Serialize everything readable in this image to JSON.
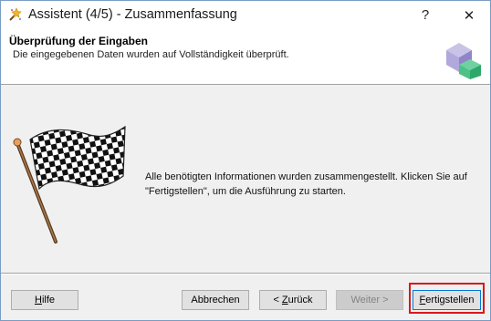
{
  "window": {
    "title": "Assistent (4/5) - Zusammenfassung",
    "help_glyph": "?",
    "close_glyph": "✕"
  },
  "header": {
    "title": "Überprüfung der Eingaben",
    "subtitle": "Die eingegebenen Daten wurden auf Vollständigkeit überprüft."
  },
  "content": {
    "message": "Alle benötigten Informationen wurden zusammengestellt. Klicken Sie auf \"Fertigstellen\", um die Ausführung zu starten.",
    "illustration": "checkered-flag-icon"
  },
  "buttons": {
    "help": {
      "mnemonic": "H",
      "rest": "ilfe"
    },
    "cancel": {
      "label": "Abbrechen"
    },
    "back": {
      "prefix": "< ",
      "mnemonic": "Z",
      "rest": "urück"
    },
    "next": {
      "label": "Weiter >"
    },
    "finish": {
      "mnemonic": "F",
      "rest": "ertigstellen"
    }
  },
  "colors": {
    "highlight": "#d9191b",
    "accent_logo": "#3cb371"
  }
}
